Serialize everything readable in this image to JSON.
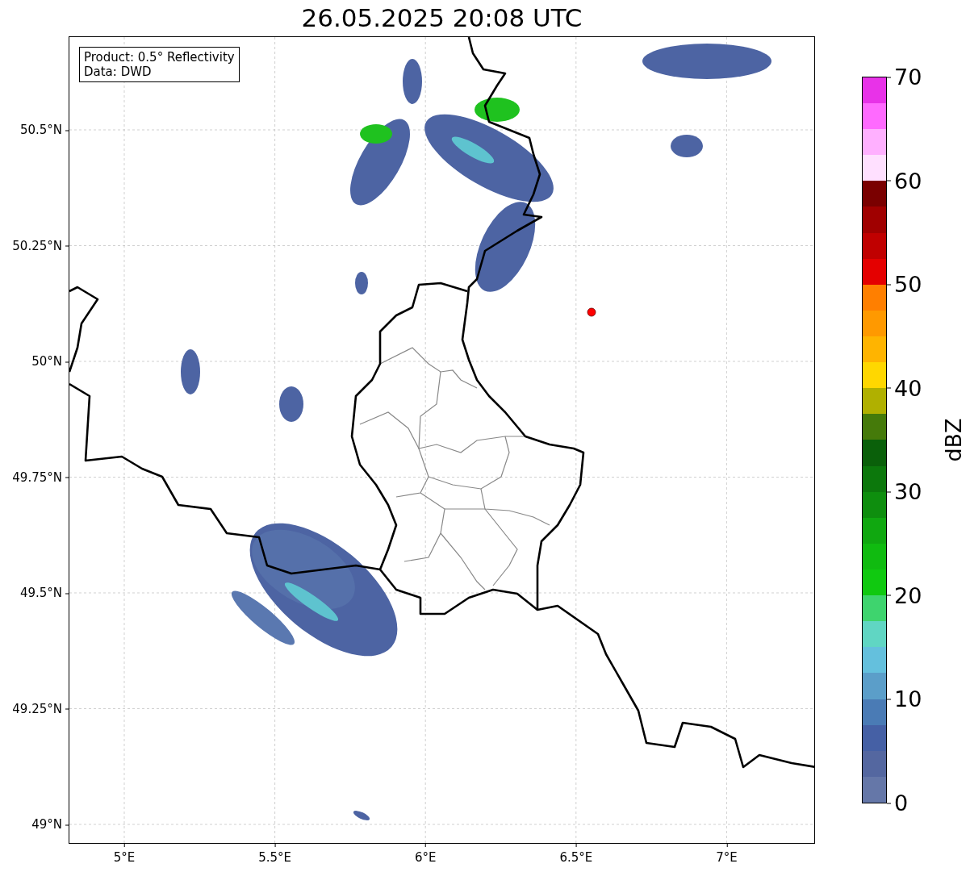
{
  "title": "26.05.2025 20:08 UTC",
  "info_box": [
    "Product: 0.5° Reflectivity",
    "Data: DWD"
  ],
  "map": {
    "y_ticks": [
      "50.5°N",
      "50.25°N",
      "50°N",
      "49.75°N",
      "49.5°N",
      "49.25°N",
      "49°N"
    ],
    "x_ticks": [
      "5°E",
      "5.5°E",
      "6°E",
      "6.5°E",
      "7°E"
    ]
  },
  "colorbar": {
    "label": "dBZ",
    "ticks": [
      "70",
      "60",
      "50",
      "40",
      "30",
      "20",
      "10",
      "0"
    ],
    "bands": [
      {
        "color": "#6577a8"
      },
      {
        "color": "#5467a0"
      },
      {
        "color": "#4560a5"
      },
      {
        "color": "#4a7bb5"
      },
      {
        "color": "#5b9ec9"
      },
      {
        "color": "#64c0dd"
      },
      {
        "color": "#60d6c3"
      },
      {
        "color": "#3ed46e"
      },
      {
        "color": "#10c910"
      },
      {
        "color": "#10bb10"
      },
      {
        "color": "#10a810"
      },
      {
        "color": "#0e8e0e"
      },
      {
        "color": "#0c780c"
      },
      {
        "color": "#0a600a"
      },
      {
        "color": "#457a0a"
      },
      {
        "color": "#b0b000"
      },
      {
        "color": "#ffd700"
      },
      {
        "color": "#ffb400"
      },
      {
        "color": "#ff9900"
      },
      {
        "color": "#ff7f00"
      },
      {
        "color": "#e40000"
      },
      {
        "color": "#c00000"
      },
      {
        "color": "#a00000"
      },
      {
        "color": "#7a0000"
      },
      {
        "color": "#ffe0ff"
      },
      {
        "color": "#ffb0ff"
      },
      {
        "color": "#ff6aff"
      },
      {
        "color": "#e832e8"
      }
    ]
  }
}
